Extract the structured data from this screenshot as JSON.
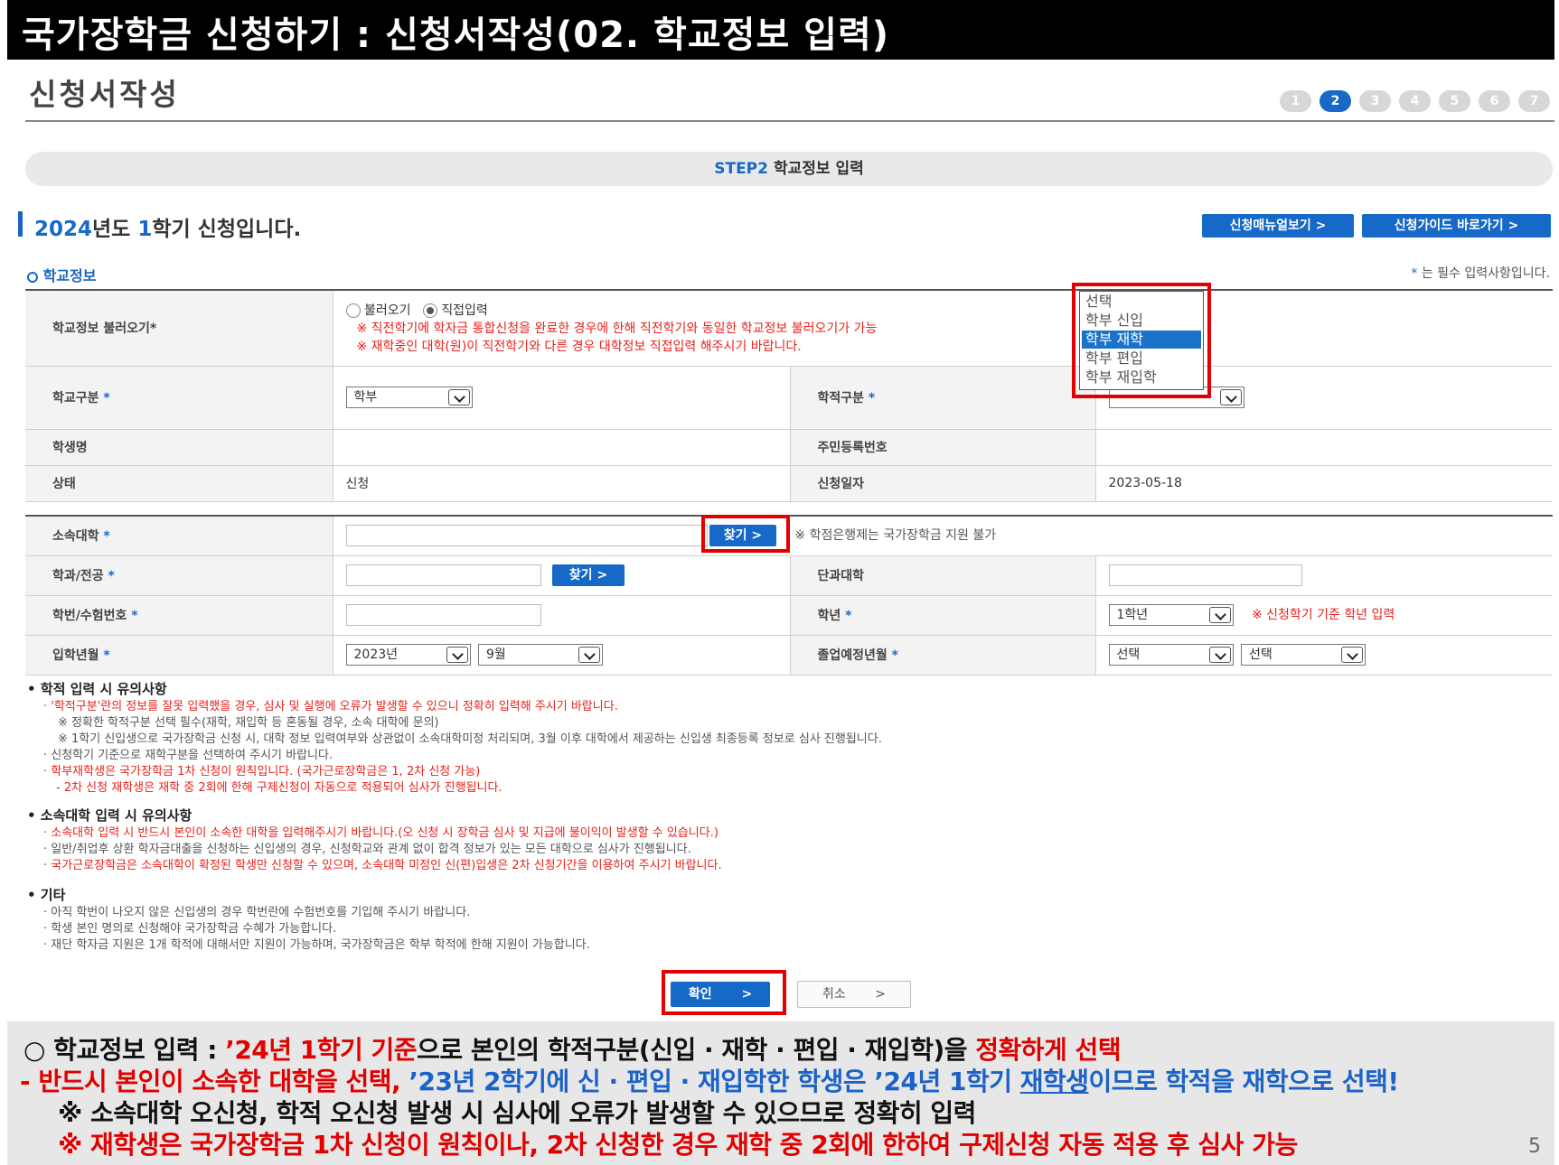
{
  "slide": {
    "title": "국가장학금 신청하기 : 신청서작성(02. 학교정보 입력)",
    "page_number": "5"
  },
  "page": {
    "heading": "신청서작성",
    "steps": [
      "1",
      "2",
      "3",
      "4",
      "5",
      "6",
      "7"
    ],
    "active_step": "2",
    "step_banner": {
      "code": "STEP2",
      "label": "학교정보 입력"
    },
    "term": {
      "year": "2024",
      "year_suffix": "년도 ",
      "semester": "1",
      "semester_suffix": "학기 신청입니다."
    },
    "manual_button": "신청매뉴얼보기 >",
    "guide_button": "신청가이드 바로가기 >",
    "section_label": "학교정보",
    "required_note_star": "*",
    "required_note": " 는 필수 입력사항입니다."
  },
  "school_info": {
    "load_label": "학교정보 불러오기*",
    "radio_load": "불러오기",
    "radio_direct": "직접입력",
    "load_note_1": "※ 직전학기에 학자금 통합신청을 완료한 경우에 한해 직전학기와 동일한 학교정보 불러오기가 가능",
    "load_note_2": "※ 재학중인 대학(원)이 직전학기와 다른 경우 대학정보 직접입력 해주시기 바랍니다.",
    "school_type_label": "학교구분",
    "school_type_value": "학부",
    "enroll_type_label": "학적구분",
    "enroll_dropdown": [
      "선택",
      "학부 신입",
      "학부 재학",
      "학부 편입",
      "학부 재입학"
    ],
    "enroll_dropdown_selected": "학부 재학",
    "student_name_label": "학생명",
    "rrn_label": "주민등록번호",
    "status_label": "상태",
    "status_value": "신청",
    "apply_date_label": "신청일자",
    "apply_date_value": "2023-05-18"
  },
  "university": {
    "university_label": "소속대학",
    "find_button": "찾기 >",
    "credit_bank_note": "※ 학점은행제는 국가장학금 지원 불가",
    "major_label": "학과/전공",
    "major_find_button": "찾기 >",
    "college_label": "단과대학",
    "student_id_label": "학번/수험번호",
    "grade_label": "학년",
    "grade_value": "1학년",
    "grade_note": "※ 신청학기 기준 학년 입력",
    "admission_label": "입학년월",
    "admission_year": "2023년",
    "admission_month": "9월",
    "graduation_label": "졸업예정년월",
    "graduation_year": "선택",
    "graduation_month": "선택"
  },
  "notes": {
    "enroll_heading": "• 학적 입력 시 유의사항",
    "enroll_1": "· '학적구분'란의 정보를 잘못 입력했을 경우, 심사 및 실행에 오류가 발생할 수 있으니 정확히 입력해 주시기 바랍니다.",
    "enroll_2": "※ 정확한 학적구분 선택 필수(재학, 재입학 등 혼동될 경우, 소속 대학에 문의)",
    "enroll_3": "※ 1학기 신입생으로 국가장학금 신청 시, 대학 정보 입력여부와 상관없이 소속대학미정 처리되며, 3월 이후 대학에서 제공하는 신입생 최종등록 정보로 심사 진행됩니다.",
    "enroll_4": "· 신청학기 기준으로 재학구분을 선택하여 주시기 바랍니다.",
    "enroll_5": "· 학부재학생은 국가장학금 1차 신청이 원칙입니다. (국가근로장학금은 1, 2차 신청 가능)",
    "enroll_6": "- 2차 신청 재학생은 재학 중 2회에 한해 구제신청이 자동으로 적용되어 심사가 진행됩니다.",
    "univ_heading": "• 소속대학 입력 시 유의사항",
    "univ_1": "· 소속대학 입력 시 반드시 본인이 소속한 대학을 입력해주시기 바랍니다.(오 신청 시 장학금 심사 및 지급에 불이익이 발생할 수 있습니다.)",
    "univ_2": "· 일반/취업후 상환 학자금대출을 신청하는 신입생의 경우, 신청학교와 관계 없이 합격 정보가 있는 모든 대학으로 심사가 진행됩니다.",
    "univ_3": "· 국가근로장학금은 소속대학이 확정된 학생만 신청할 수 있으며, 소속대학 미정인 신(편)입생은 2차 신청기간을 이용하여 주시기 바랍니다.",
    "etc_heading": "• 기타",
    "etc_1": "· 아직 학번이 나오지 않은 신입생의 경우 학번란에 수험번호를 기입해 주시기 바랍니다.",
    "etc_2": "· 학생 본인 명의로 신청해야 국가장학금 수혜가 가능합니다.",
    "etc_3": "· 재단 학자금 지원은 1개 학적에 대해서만 지원이 가능하며, 국가장학금은 학부 학적에 한해 지원이 가능합니다."
  },
  "buttons": {
    "confirm": "확인",
    "cancel": "취소"
  },
  "summary": {
    "l1_a": "○ 학교정보 입력 : ",
    "l1_b": "’24년 1학기 기준",
    "l1_c": "으로 본인의 학적구분(신입 · 재학 · 편입 · 재입학)을 ",
    "l1_d": "정확하게 선택",
    "l2_a": " - 반드시 본인이 소속한 대학을 선택, ",
    "l2_b": "’23년 2학기에 신 · 편입 · 재입학한 학생은 ’24년 1학기 ",
    "l2_c": "재학생",
    "l2_d": "이므로 학적을 재학으로 선택!",
    "l3": "※ 소속대학 오신청, 학적 오신청 발생 시 심사에 오류가 발생할 수 있으므로 정확히 입력",
    "l4": "※ 재학생은 국가장학금 1차 신청이 원칙이나, 2차 신청한 경우 재학 중 2회에 한하여 구제신청 자동 적용 후 심사 가능"
  },
  "colors": {
    "accent_blue": "#1769c7",
    "highlight_red": "#e40000",
    "note_red": "#e8221b"
  }
}
